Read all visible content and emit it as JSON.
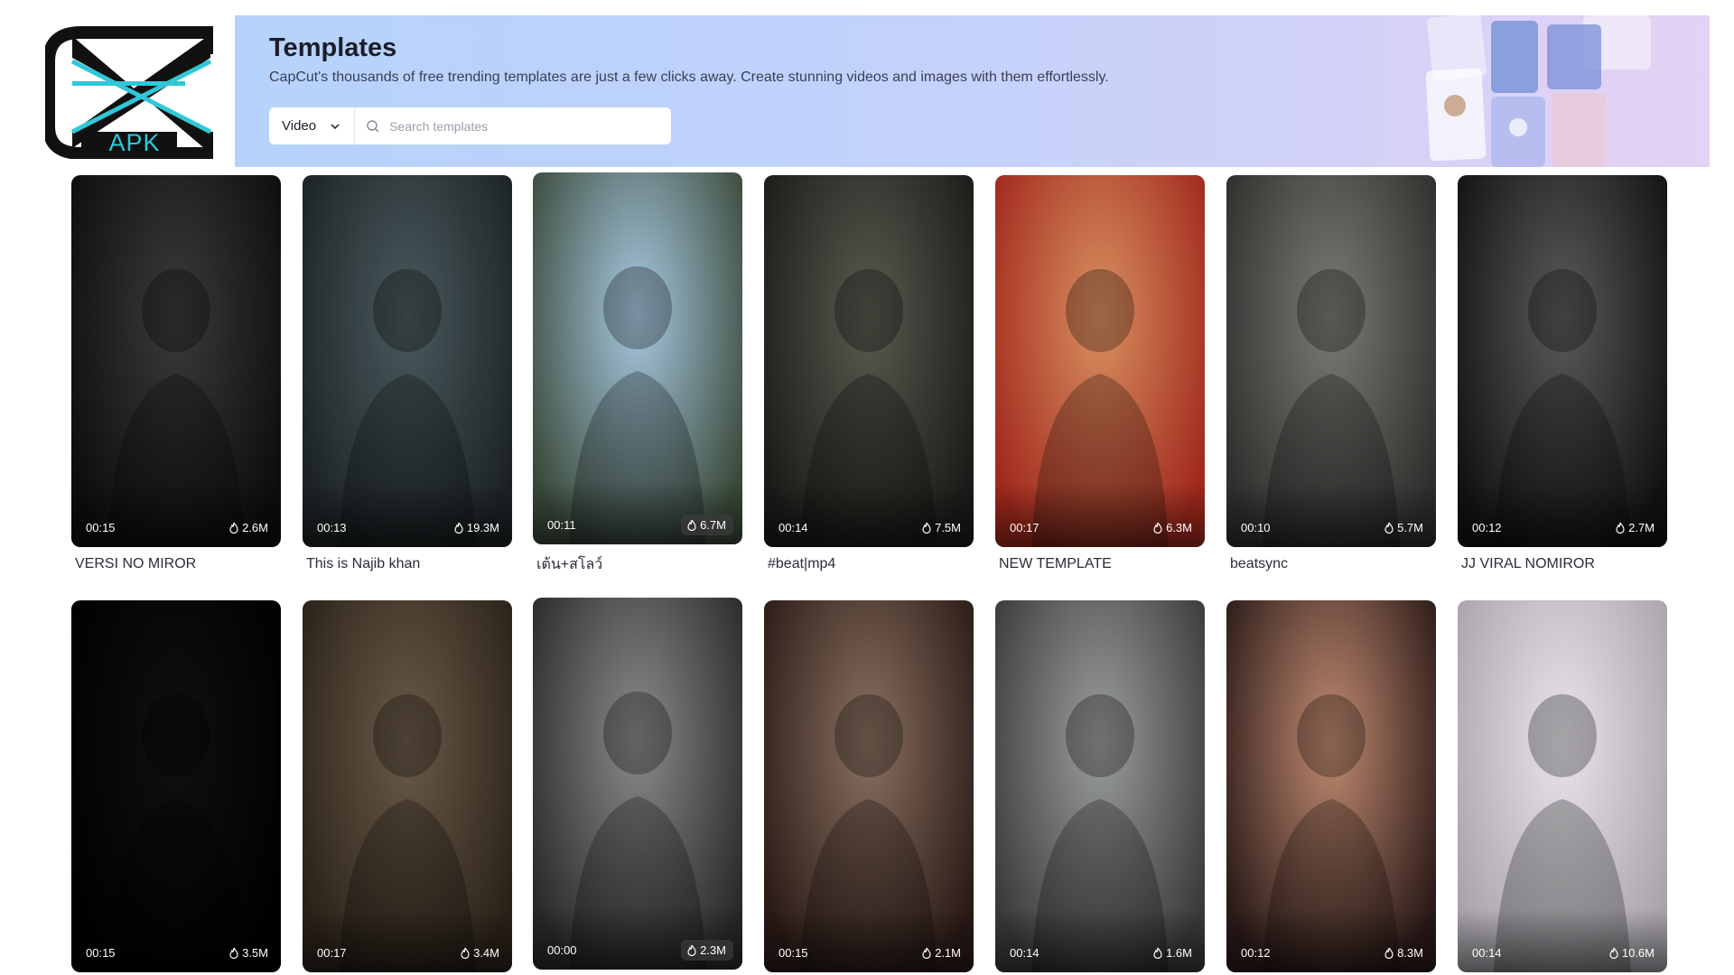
{
  "logo": {
    "text": "APK"
  },
  "banner": {
    "title": "Templates",
    "subtitle": "CapCut's thousands of free trending templates are just a few clicks away. Create stunning videos and images with them effortlessly.",
    "type_select": "Video",
    "search_placeholder": "Search templates"
  },
  "colors": {
    "accent_cyan": "#2fc8d8",
    "text_dark": "#1b1d29"
  },
  "templates": [
    {
      "title": "VERSI NO MIROR",
      "duration": "00:15",
      "views": "2.6M",
      "tone": [
        "#3a3a3a",
        "#0d0d0d"
      ]
    },
    {
      "title": "This is Najib khan",
      "duration": "00:13",
      "views": "19.3M",
      "tone": [
        "#4a5a5e",
        "#1c2224"
      ]
    },
    {
      "title": "เต้น+สโลว์",
      "duration": "00:11",
      "views": "6.7M",
      "tone": [
        "#a7c8e0",
        "#3a4a3a"
      ]
    },
    {
      "title": "#beat|mp4",
      "duration": "00:14",
      "views": "7.5M",
      "tone": [
        "#5a5a50",
        "#1a1a18"
      ]
    },
    {
      "title": "NEW TEMPLATE",
      "duration": "00:17",
      "views": "6.3M",
      "tone": [
        "#d89060",
        "#a0281c"
      ]
    },
    {
      "title": "beatsync",
      "duration": "00:10",
      "views": "5.7M",
      "tone": [
        "#7a7a76",
        "#2e2e2c"
      ]
    },
    {
      "title": "JJ VIRAL NOMIROR",
      "duration": "00:12",
      "views": "2.7M",
      "tone": [
        "#5a5a5a",
        "#121212"
      ]
    },
    {
      "title": "",
      "duration": "00:15",
      "views": "3.5M",
      "tone": [
        "#101010",
        "#000000"
      ]
    },
    {
      "title": "",
      "duration": "00:17",
      "views": "3.4M",
      "tone": [
        "#6a5a48",
        "#2a2218"
      ]
    },
    {
      "title": "",
      "duration": "00:00",
      "views": "2.3M",
      "tone": [
        "#8a8a88",
        "#2a2a2a"
      ]
    },
    {
      "title": "",
      "duration": "00:15",
      "views": "2.1M",
      "tone": [
        "#8a7060",
        "#2a1a16"
      ]
    },
    {
      "title": "",
      "duration": "00:14",
      "views": "1.6M",
      "tone": [
        "#9a9e9c",
        "#3a3a3a"
      ]
    },
    {
      "title": "",
      "duration": "00:12",
      "views": "8.3M",
      "tone": [
        "#c08a70",
        "#2a1a18"
      ]
    },
    {
      "title": "",
      "duration": "00:14",
      "views": "10.6M",
      "tone": [
        "#e8e4ea",
        "#a8a4aa"
      ]
    }
  ]
}
